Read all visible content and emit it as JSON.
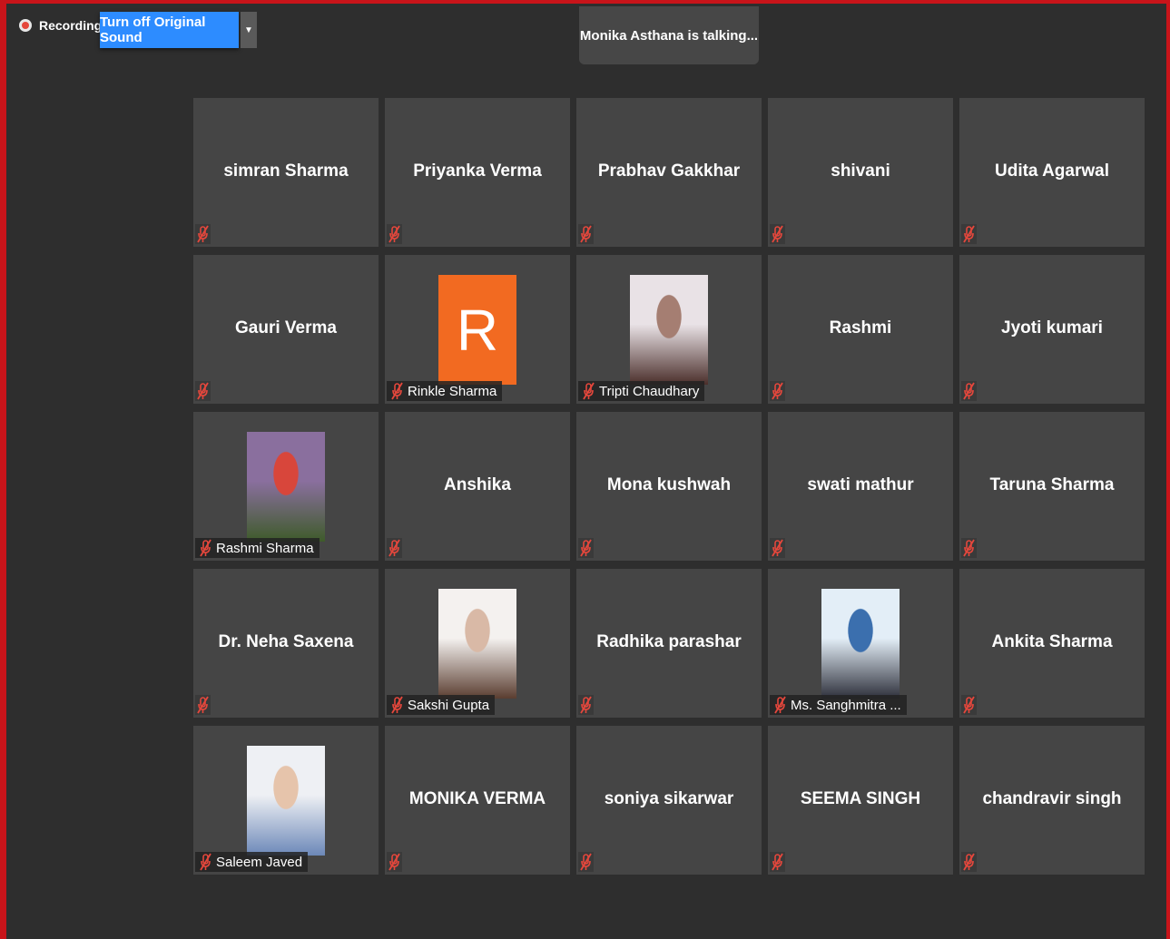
{
  "toolbar": {
    "recording_label": "Recording",
    "original_sound_button": "Turn off Original Sound"
  },
  "talking_indicator": "Monika Asthana is talking...",
  "participants": [
    {
      "name": "simran Sharma"
    },
    {
      "name": "Priyanka Verma"
    },
    {
      "name": "Prabhav Gakkhar"
    },
    {
      "name": "shivani"
    },
    {
      "name": "Udita Agarwal"
    },
    {
      "name": "Gauri Verma"
    },
    {
      "name": "Rinkle Sharma",
      "avatar": "letter",
      "initial": "R",
      "avatar_color": "#f26a21"
    },
    {
      "name": "Tripti Chaudhary",
      "avatar": "photo",
      "photo_colors": [
        "#e9e2e6",
        "#a57e72",
        "#4a2e2a"
      ]
    },
    {
      "name": "Rashmi"
    },
    {
      "name": "Jyoti kumari"
    },
    {
      "name": "Rashmi Sharma",
      "avatar": "photo",
      "photo_colors": [
        "#8a6f9e",
        "#d8463b",
        "#3e5b2a"
      ]
    },
    {
      "name": "Anshika"
    },
    {
      "name": "Mona kushwah"
    },
    {
      "name": "swati mathur"
    },
    {
      "name": "Taruna Sharma"
    },
    {
      "name": "Dr. Neha Saxena"
    },
    {
      "name": "Sakshi Gupta",
      "avatar": "photo",
      "photo_colors": [
        "#f4f1ef",
        "#d9b9a6",
        "#5a3d30"
      ]
    },
    {
      "name": "Radhika parashar"
    },
    {
      "name": "Ms. Sanghmitra ...",
      "avatar": "photo",
      "photo_colors": [
        "#e3eef7",
        "#3b6fae",
        "#2d2f3a"
      ]
    },
    {
      "name": "Ankita Sharma"
    },
    {
      "name": "Saleem Javed",
      "avatar": "photo",
      "photo_colors": [
        "#eef0f4",
        "#e6c4ab",
        "#6c88b8"
      ]
    },
    {
      "name": "MONIKA VERMA"
    },
    {
      "name": "soniya sikarwar"
    },
    {
      "name": "SEEMA SINGH"
    },
    {
      "name": "chandravir singh"
    }
  ],
  "colors": {
    "background": "#2e2e2e",
    "tile": "#454545",
    "accent": "#2d8cff",
    "muted_mic": "#e5473c",
    "frame_border": "#c8141a"
  },
  "icons": {
    "recording": "recording-dot-icon",
    "dropdown": "chevron-down-icon",
    "muted": "muted-mic-icon"
  }
}
